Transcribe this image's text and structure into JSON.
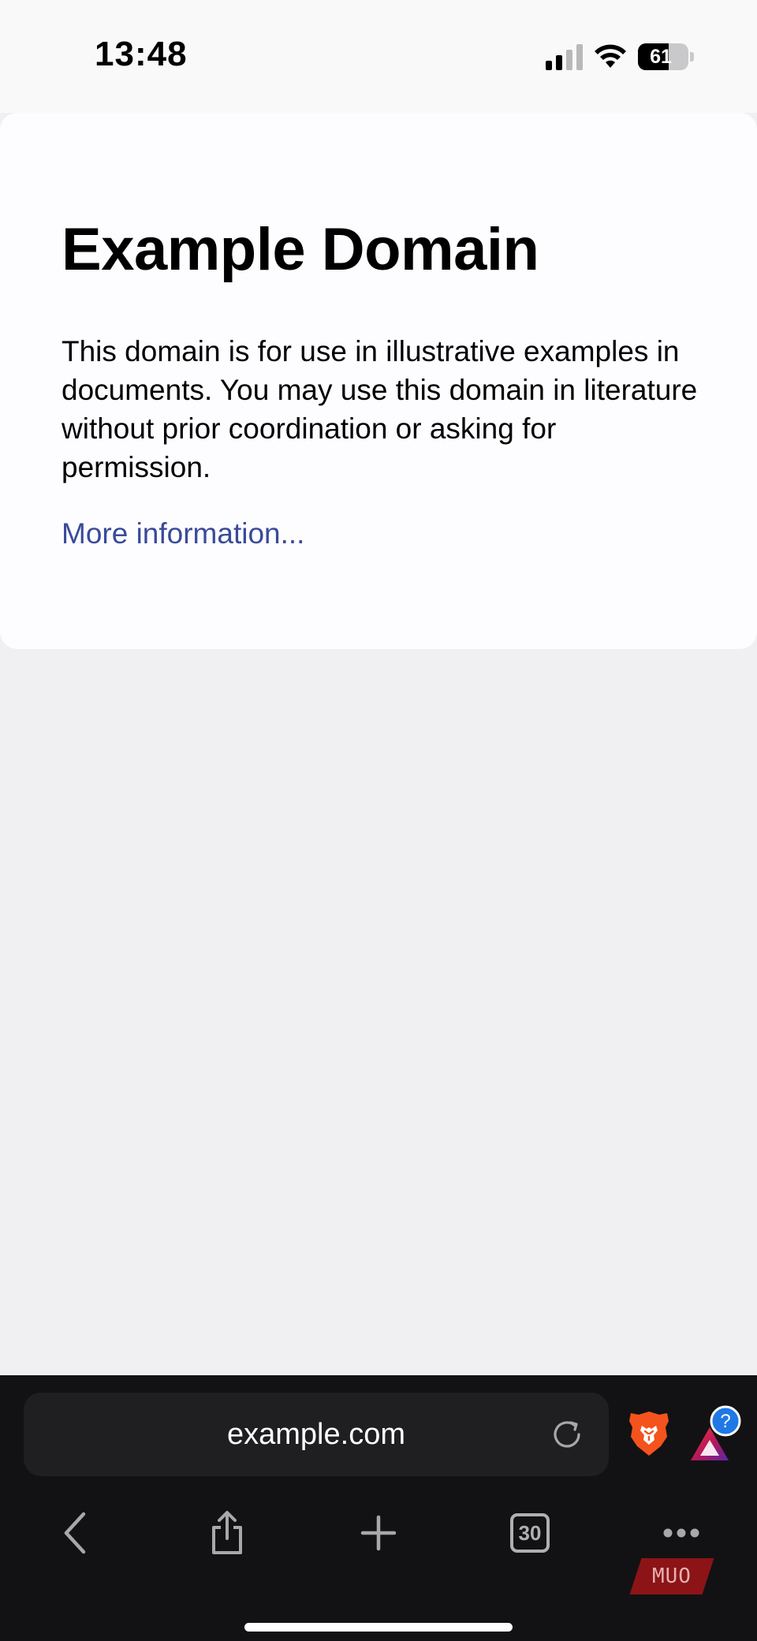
{
  "status_bar": {
    "time": "13:48",
    "battery_level": "61",
    "icons": [
      "cellular-signal-icon",
      "wifi-icon",
      "battery-icon"
    ]
  },
  "page": {
    "title": "Example Domain",
    "body": "This domain is for use in illustrative examples in documents. You may use this domain in literature without prior coordination or asking for permission.",
    "link_text": "More information...",
    "link_color": "#3a4a9a"
  },
  "toolbar": {
    "url": "example.com",
    "tab_count": "30",
    "icons": [
      "reload-icon",
      "brave-shields-icon",
      "brave-rewards-icon",
      "back-icon",
      "share-icon",
      "new-tab-icon",
      "tabs-icon",
      "more-icon"
    ],
    "rewards_badge": "?"
  },
  "watermark": "MUO",
  "colors": {
    "toolbar_bg": "#121214",
    "url_bar_bg": "#1f1f21",
    "page_bg": "#f0f0f2",
    "brave_orange": "#f4531d"
  }
}
